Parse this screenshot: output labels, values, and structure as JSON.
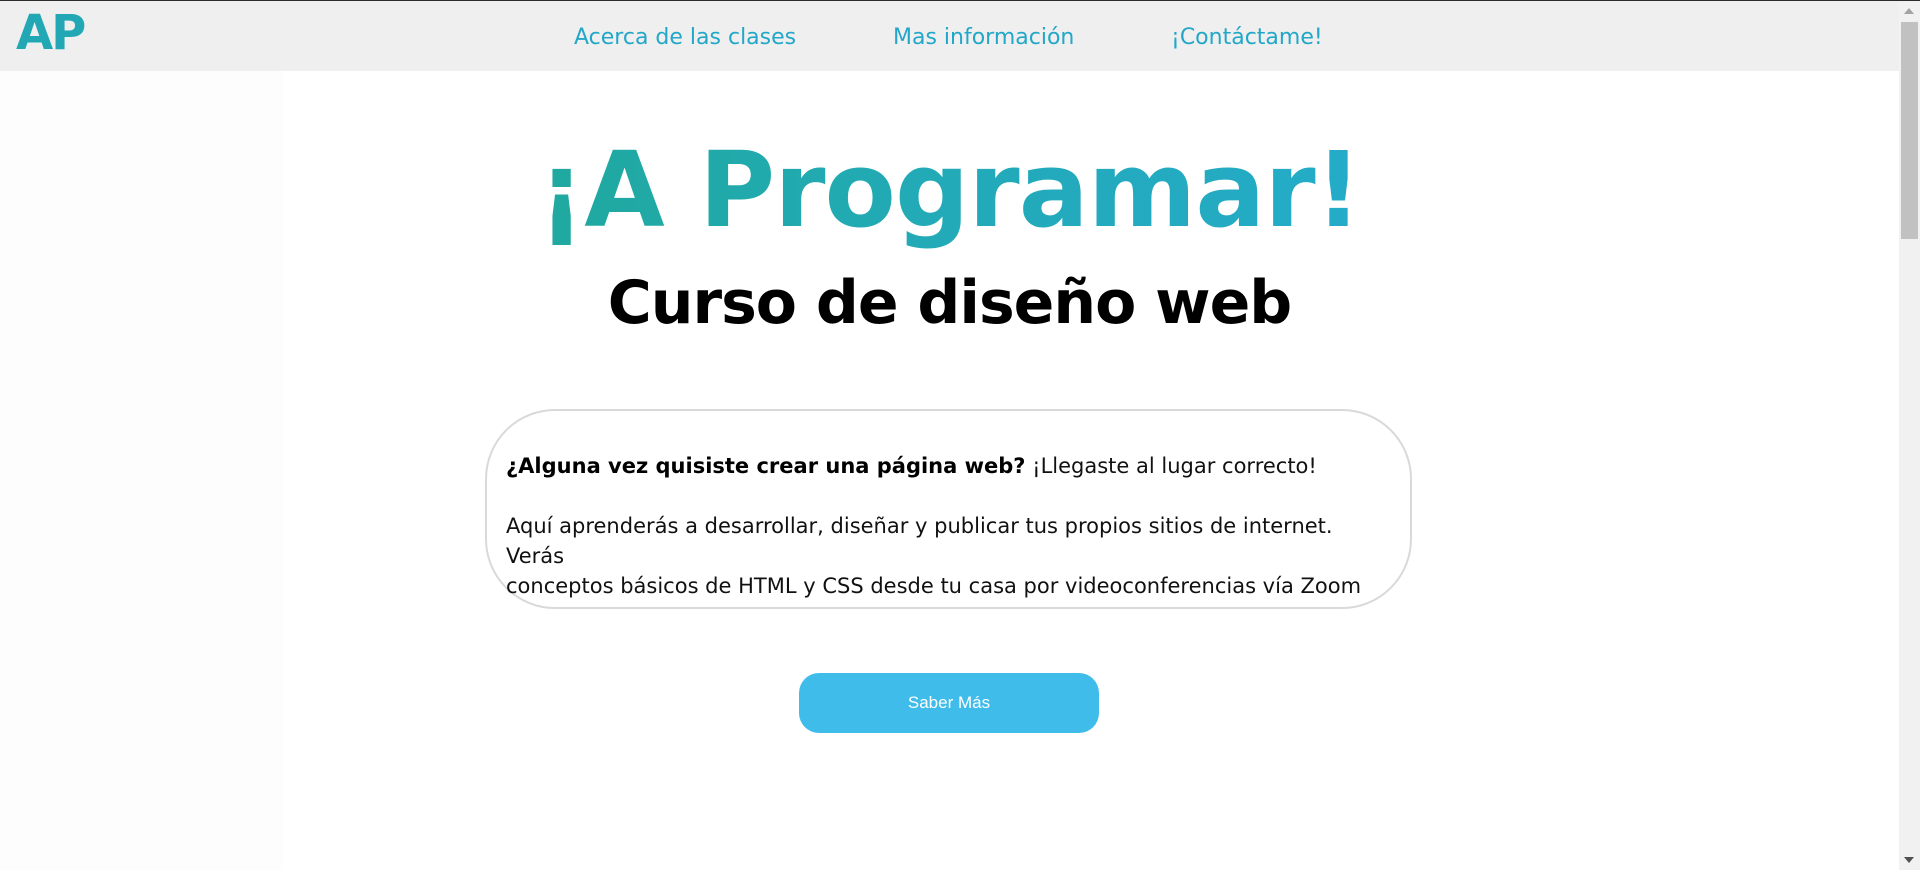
{
  "header": {
    "logo": "AP",
    "nav": [
      {
        "label": "Acerca de las clases"
      },
      {
        "label": "Mas información"
      },
      {
        "label": "¡Contáctame!"
      }
    ]
  },
  "hero": {
    "title": "¡A Programar!",
    "subtitle": "Curso de diseño web"
  },
  "intro": {
    "question": "¿Alguna vez quisiste crear una página web?",
    "answer": " ¡Llegaste al lugar correcto!",
    "body_line1": "Aquí aprenderás a desarrollar, diseñar y publicar tus propios sitios de internet. Verás",
    "body_line2": "conceptos básicos de HTML y CSS desde tu casa por videoconferencias vía Zoom"
  },
  "cta": {
    "label": "Saber Más"
  },
  "colors": {
    "accent": "#22a7c8",
    "title_gradient_start": "#1fa88f",
    "title_gradient_end": "#26acd2",
    "button": "#3fbcea"
  }
}
